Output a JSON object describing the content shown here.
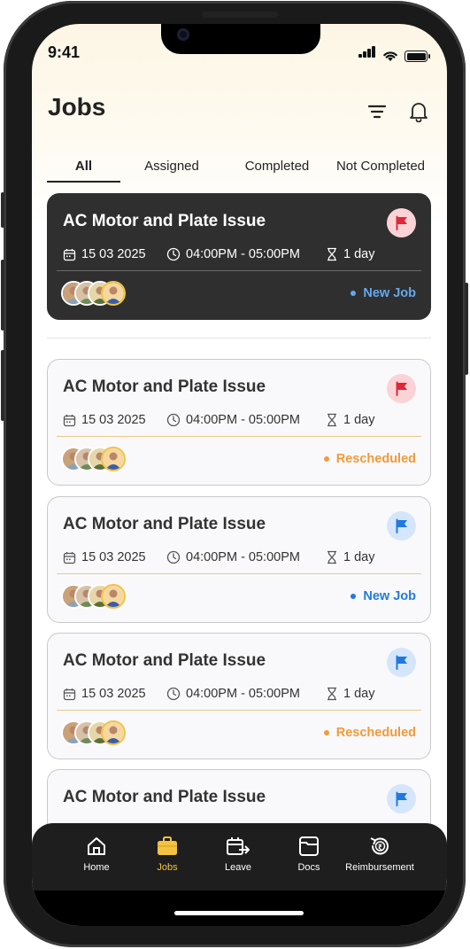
{
  "status_bar": {
    "time": "9:41"
  },
  "header": {
    "title": "Jobs",
    "filter_icon": "filter-icon",
    "bell_icon": "bell-icon"
  },
  "tabs": [
    {
      "label": "All",
      "active": true
    },
    {
      "label": "Assigned",
      "active": false
    },
    {
      "label": "Completed",
      "active": false
    },
    {
      "label": "Not Completed",
      "active": false
    }
  ],
  "jobs": [
    {
      "title": "AC Motor and Plate Issue",
      "date": "15 03 2025",
      "time": "04:00PM - 05:00PM",
      "duration": "1 day",
      "status": "New Job",
      "status_color": "#62a8f0",
      "flag_color": "#e0283a",
      "flag_bg": "#fbd3d6",
      "dark": true
    },
    {
      "title": "AC Motor and Plate Issue",
      "date": "15 03 2025",
      "time": "04:00PM - 05:00PM",
      "duration": "1 day",
      "status": "Rescheduled",
      "status_color": "#f39a3a",
      "flag_color": "#e0283a",
      "flag_bg": "#fbd3d6",
      "dark": false
    },
    {
      "title": "AC Motor and Plate Issue",
      "date": "15 03 2025",
      "time": "04:00PM - 05:00PM",
      "duration": "1 day",
      "status": "New Job",
      "status_color": "#1f7ae0",
      "flag_color": "#1f7ae0",
      "flag_bg": "#d5e6fb",
      "dark": false
    },
    {
      "title": "AC Motor and Plate Issue",
      "date": "15 03 2025",
      "time": "04:00PM - 05:00PM",
      "duration": "1 day",
      "status": "Rescheduled",
      "status_color": "#f39a3a",
      "flag_color": "#1f7ae0",
      "flag_bg": "#d5e6fb",
      "dark": false
    },
    {
      "title": "AC Motor and Plate Issue",
      "flag_color": "#1f7ae0",
      "flag_bg": "#d5e6fb",
      "dark": false
    }
  ],
  "bottom_nav": [
    {
      "label": "Home",
      "icon": "home-icon",
      "active": false
    },
    {
      "label": "Jobs",
      "icon": "briefcase-icon",
      "active": true
    },
    {
      "label": "Leave",
      "icon": "leave-icon",
      "active": false
    },
    {
      "label": "Docs",
      "icon": "docs-icon",
      "active": false
    },
    {
      "label": "Reimbursement",
      "icon": "reimbursement-icon",
      "active": false
    }
  ],
  "colors": {
    "accent": "#f3c244",
    "dark_card": "#2f2f2f",
    "nav_bg": "#1e1e1e"
  }
}
